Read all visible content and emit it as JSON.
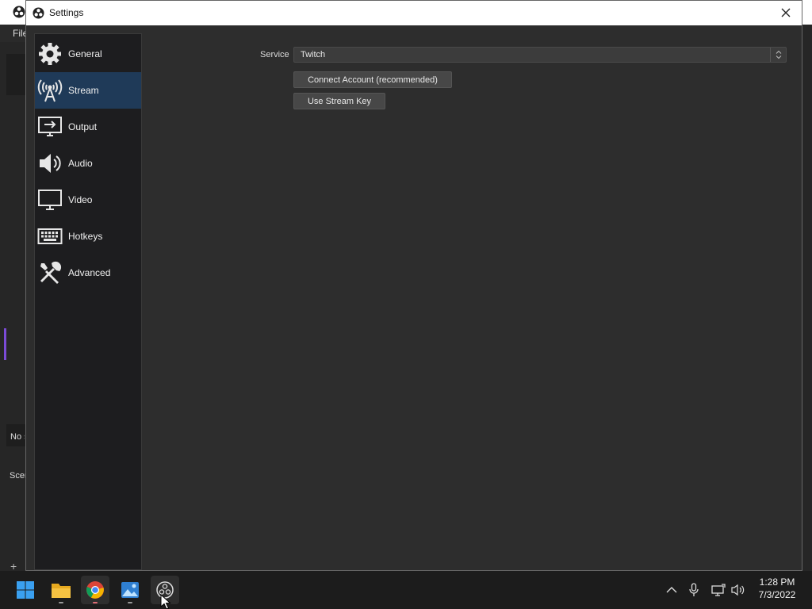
{
  "background_app": {
    "menu_file": "File",
    "no_source_label": "No s",
    "scenes_label": "Scen"
  },
  "settings": {
    "title": "Settings",
    "nav": [
      {
        "label": "General",
        "icon": "gear-icon"
      },
      {
        "label": "Stream",
        "icon": "antenna-icon",
        "active": true
      },
      {
        "label": "Output",
        "icon": "output-icon"
      },
      {
        "label": "Audio",
        "icon": "speaker-icon"
      },
      {
        "label": "Video",
        "icon": "monitor-icon"
      },
      {
        "label": "Hotkeys",
        "icon": "keyboard-icon"
      },
      {
        "label": "Advanced",
        "icon": "tools-icon"
      }
    ],
    "stream": {
      "service_label": "Service",
      "service_value": "Twitch",
      "connect_account_label": "Connect Account (recommended)",
      "use_stream_key_label": "Use Stream Key"
    }
  },
  "taskbar": {
    "apps": [
      "start-icon",
      "file-explorer-icon",
      "chrome-icon",
      "photos-icon",
      "obs-icon"
    ],
    "tray": [
      "chevron-up-icon",
      "microphone-icon",
      "network-icon",
      "volume-icon"
    ],
    "time": "1:28 PM",
    "date": "7/3/2022"
  },
  "colors": {
    "active_nav": "#1f3a58",
    "dialog_bg": "#2d2d2d",
    "sidebar_bg": "#1d1d1f"
  }
}
